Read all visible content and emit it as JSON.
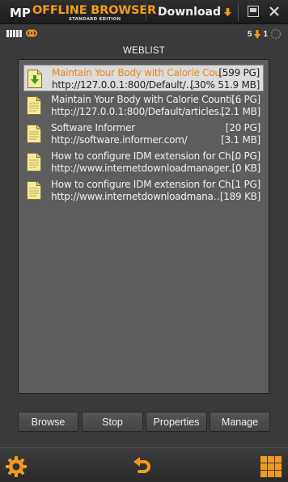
{
  "app": {
    "brand_prefix": "MP",
    "brand_name": "OFFLINE BROWSER",
    "edition": "STANDARD EDITION"
  },
  "toolbar": {
    "download_label": "Download"
  },
  "status": {
    "queued_count": "5",
    "active_count": "1"
  },
  "weblist": {
    "title": "WEBLIST",
    "rows": [
      {
        "title": "Maintain Your Body with Calorie Cou…",
        "url": "http://127.0.0.1:800/Default/…",
        "pages": "[599 PG]",
        "size": "[30% 51.9 MB]",
        "icon": "page-download-icon",
        "selected": true
      },
      {
        "title": "Maintain Your Body with Calorie Counti…",
        "url": "http://127.0.0.1:800/Default/articles…",
        "pages": "[6 PG]",
        "size": "[2.1 MB]",
        "icon": "page-icon",
        "selected": false
      },
      {
        "title": "Software Informer",
        "url": "http://software.informer.com/",
        "pages": "[20 PG]",
        "size": "[3.1 MB]",
        "icon": "page-icon",
        "selected": false
      },
      {
        "title": "How to configure IDM extension for Ch…",
        "url": "http://www.internetdownloadmanager…",
        "pages": "[0 PG]",
        "size": "[0 KB]",
        "icon": "page-icon",
        "selected": false
      },
      {
        "title": "How to configure IDM extension for Ch…",
        "url": "http://www.internetdownloadmana…",
        "pages": "[1 PG]",
        "size": "[189 KB]",
        "icon": "page-icon",
        "selected": false
      }
    ]
  },
  "buttons": {
    "browse": "Browse",
    "stop": "Stop",
    "properties": "Properties",
    "manage": "Manage"
  },
  "colors": {
    "accent": "#f39a1c",
    "background": "#3a3a3a",
    "list_background": "#5d5d5d",
    "selected_row": "#dcdcdc",
    "selected_title": "#e8841a"
  }
}
